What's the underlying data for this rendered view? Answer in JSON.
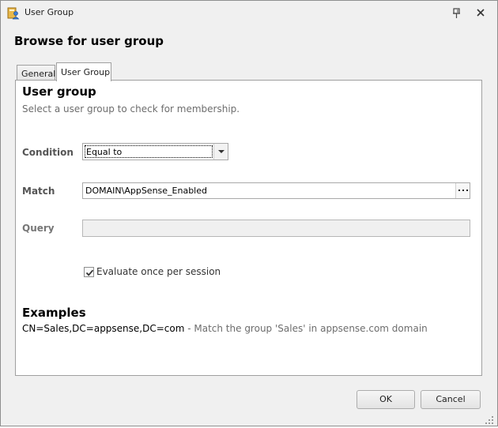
{
  "window": {
    "title": "User Group",
    "icon": "user-group-app-icon",
    "pin_icon": "pin-icon",
    "close_icon": "close-icon"
  },
  "dialog": {
    "heading": "Browse for user group"
  },
  "tabs": [
    {
      "label": "General",
      "active": false
    },
    {
      "label": "User Group",
      "active": true
    }
  ],
  "panel": {
    "title": "User group",
    "subtitle": "Select a user group to check for membership.",
    "condition": {
      "label": "Condition",
      "value": "Equal to"
    },
    "match": {
      "label": "Match",
      "value": "DOMAIN\\AppSense_Enabled",
      "browse_icon": "ellipsis-icon"
    },
    "query": {
      "label": "Query",
      "value": ""
    },
    "evaluate": {
      "label": "Evaluate once per session",
      "checked": true
    },
    "examples": {
      "title": "Examples",
      "code": "CN=Sales,DC=appsense,DC=com",
      "description": " - Match the group 'Sales' in appsense.com domain"
    }
  },
  "buttons": {
    "ok": "OK",
    "cancel": "Cancel"
  },
  "colors": {
    "window_bg": "#f0f0f0",
    "panel_bg": "#ffffff",
    "border": "#a0a0a0",
    "muted_text": "#6d6d6d"
  }
}
